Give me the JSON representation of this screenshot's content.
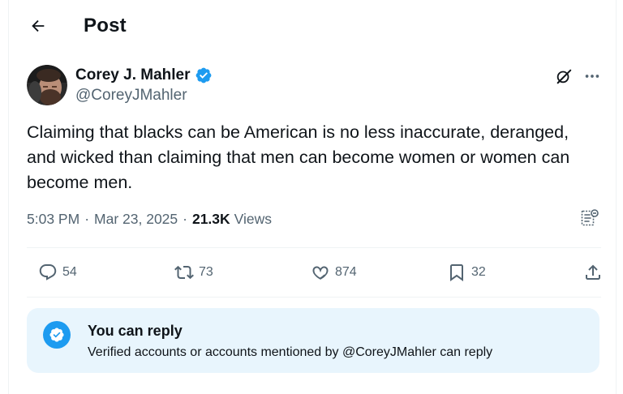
{
  "header": {
    "title": "Post",
    "back_icon": "arrow-left-icon"
  },
  "author": {
    "name": "Corey J. Mahler",
    "handle": "@CoreyJMahler",
    "verified": true,
    "verified_color": "#1d9bf0"
  },
  "post": {
    "text": "Claiming that blacks can be American is no less inaccurate, deranged, and wicked than claiming that men can become women or women can become men."
  },
  "meta": {
    "time": "5:03 PM",
    "separator": "·",
    "date": "Mar 23, 2025",
    "views_count": "21.3K",
    "views_label": "Views"
  },
  "actions": {
    "replies": "54",
    "reposts": "73",
    "likes": "874",
    "bookmarks": "32"
  },
  "reply_restriction": {
    "title": "You can reply",
    "description": "Verified accounts or accounts mentioned by @CoreyJMahler can reply",
    "banner_color": "#e8f5fd",
    "icon_color": "#1d9bf0"
  },
  "colors": {
    "text_primary": "#0f1419",
    "text_secondary": "#536471",
    "accent": "#1d9bf0",
    "divider": "#eff3f4"
  }
}
